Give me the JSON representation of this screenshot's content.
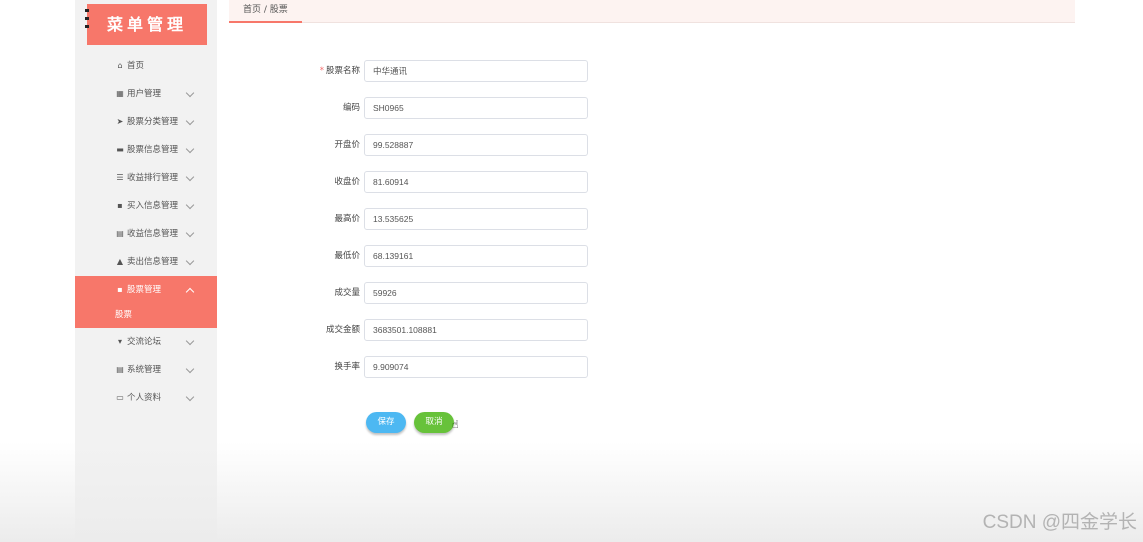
{
  "sidebar": {
    "logo": "菜单管理",
    "items": [
      {
        "label": "首页",
        "icon": "home-icon",
        "glyph": "⌂",
        "expandable": false,
        "active": false
      },
      {
        "label": "用户管理",
        "icon": "grid-icon",
        "glyph": "▦",
        "expandable": true,
        "active": false
      },
      {
        "label": "股票分类管理",
        "icon": "send-icon",
        "glyph": "➤",
        "expandable": true,
        "active": false
      },
      {
        "label": "股票信息管理",
        "icon": "chat-icon",
        "glyph": "▬",
        "expandable": true,
        "active": false
      },
      {
        "label": "收益排行管理",
        "icon": "list-icon",
        "glyph": "☰",
        "expandable": true,
        "active": false
      },
      {
        "label": "买入信息管理",
        "icon": "apps-icon",
        "glyph": "▪",
        "expandable": true,
        "active": false
      },
      {
        "label": "收益信息管理",
        "icon": "document-icon",
        "glyph": "▤",
        "expandable": true,
        "active": false
      },
      {
        "label": "卖出信息管理",
        "icon": "user-icon",
        "glyph": "▲",
        "expandable": true,
        "active": false
      },
      {
        "label": "股票管理",
        "icon": "apps-icon",
        "glyph": "▪",
        "expandable": true,
        "active": true,
        "sub": [
          "股票"
        ]
      },
      {
        "label": "交流论坛",
        "icon": "comment-icon",
        "glyph": "▾",
        "expandable": true,
        "active": false
      },
      {
        "label": "系统管理",
        "icon": "document-icon",
        "glyph": "▤",
        "expandable": true,
        "active": false
      },
      {
        "label": "个人资料",
        "icon": "calendar-icon",
        "glyph": "▭",
        "expandable": true,
        "active": false
      }
    ]
  },
  "breadcrumb": "首页 / 股票",
  "form": {
    "fields": [
      {
        "label": "股票名称",
        "required": true,
        "value": "中华通讯"
      },
      {
        "label": "编码",
        "required": false,
        "value": "SH0965"
      },
      {
        "label": "开盘价",
        "required": false,
        "value": "99.528887"
      },
      {
        "label": "收盘价",
        "required": false,
        "value": "81.60914"
      },
      {
        "label": "最高价",
        "required": false,
        "value": "13.535625"
      },
      {
        "label": "最低价",
        "required": false,
        "value": "68.139161"
      },
      {
        "label": "成交量",
        "required": false,
        "value": "59926"
      },
      {
        "label": "成交金额",
        "required": false,
        "value": "3683501.108881"
      },
      {
        "label": "换手率",
        "required": false,
        "value": "9.909074"
      }
    ],
    "save_label": "保存",
    "cancel_label": "取消"
  },
  "watermark": "CSDN @四金学长",
  "colors": {
    "accent": "#f7776a",
    "save": "#4db8f2",
    "cancel": "#67c23a"
  }
}
